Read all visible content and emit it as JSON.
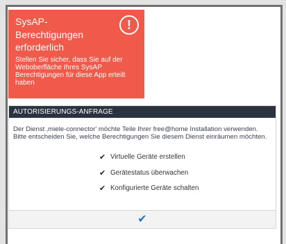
{
  "alert": {
    "title": "SysAP-Berechtigungen erforderlich",
    "body": "Stellen Sie sicher, dass Sie auf der Weboberfläche Ihres SysAP Berechtigungen für diese App erteilt haben",
    "icon": "exclamation-circle-icon",
    "color": "#f05a4a"
  },
  "auth": {
    "header": "AUTORISIERUNGS-ANFRAGE",
    "description": "Der Dienst ‚miele-connector' möchte Teile Ihrer free@home Installation verwenden. Bitte entscheiden Sie, welche Berechtigungen Sie diesem Dienst einräumen möchten.",
    "permissions": [
      {
        "label": "Virtuelle Geräte erstellen",
        "checked": true
      },
      {
        "label": "Gerätestatus überwachen",
        "checked": true
      },
      {
        "label": "Konfigurierte Geräte schalten",
        "checked": true
      }
    ],
    "confirm_icon": "checkmark-icon",
    "confirm_glyph": "✔",
    "check_glyph": "✔"
  }
}
